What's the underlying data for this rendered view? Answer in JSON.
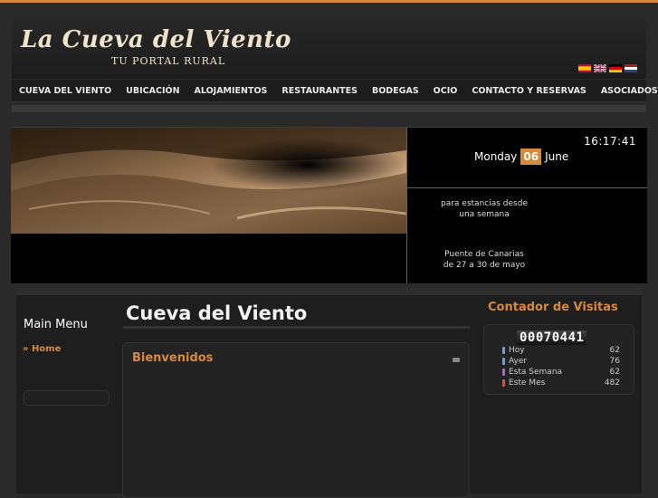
{
  "colors": {
    "accent": "#d88a3c",
    "background": "#2a2a2a",
    "panel": "#1e1e1e"
  },
  "header": {
    "logo_title": "La Cueva del Viento",
    "logo_subtitle": "TU PORTAL RURAL",
    "languages": [
      "es",
      "en",
      "de",
      "nl"
    ]
  },
  "nav": {
    "items": [
      "CUEVA DEL VIENTO",
      "UBICACIÓN",
      "ALOJAMIENTOS",
      "RESTAURANTES",
      "BODEGAS",
      "OCIO",
      "CONTACTO Y RESERVAS",
      "ASOCIADOS"
    ]
  },
  "banner": {
    "time": "16:17:41",
    "weekday": "Monday",
    "day": "06",
    "month": "June",
    "promo1_line1": "para estancias desde",
    "promo1_line2": "una semana",
    "promo2_line1": "Puente de Canarias",
    "promo2_line2": "de 27 a 30 de mayo"
  },
  "sidebar": {
    "title": "Main Menu",
    "items": [
      {
        "label": "» Home"
      }
    ]
  },
  "content": {
    "page_title": "Cueva del Viento",
    "article_title": "Bienvenidos"
  },
  "visits": {
    "title": "Contador de Visitas",
    "counter": "00070441",
    "rows": [
      {
        "label": "Hoy",
        "value": "62",
        "color": "#6aa0e0"
      },
      {
        "label": "Ayer",
        "value": "76",
        "color": "#6aa0e0"
      },
      {
        "label": "Esta Semana",
        "value": "62",
        "color": "#b060d0"
      },
      {
        "label": "Este Mes",
        "value": "482",
        "color": "#e05030"
      }
    ]
  }
}
